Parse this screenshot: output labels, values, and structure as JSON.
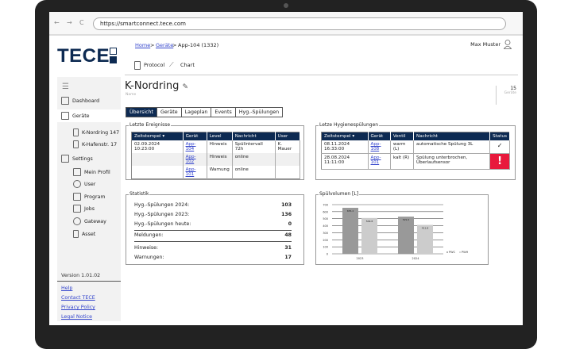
{
  "browser": {
    "back": "←",
    "forward": "→",
    "reload": "C",
    "url": "https://smartconnect.tece.com"
  },
  "logo": "TECE",
  "breadcrumb": {
    "home": "Home",
    "sep1": ">",
    "geraete": "Geräte",
    "sep2": ">",
    "current": "App-104 (1332)"
  },
  "user": {
    "name": "Max Muster"
  },
  "toolbar": {
    "protocol": "Protocol",
    "chart": "Chart"
  },
  "sidebar": {
    "items": [
      {
        "label": "Dashboard"
      },
      {
        "label": "Geräte"
      },
      {
        "label": "K-Nordring 147"
      },
      {
        "label": "K-Hafenstr. 17"
      },
      {
        "label": "Settings"
      },
      {
        "label": "Mein Profil"
      },
      {
        "label": "User"
      },
      {
        "label": "Program"
      },
      {
        "label": "Jobs"
      },
      {
        "label": "Gateway"
      },
      {
        "label": "Asset"
      }
    ],
    "version": "Version 1.01.02",
    "links": [
      "Help",
      "Contact TECE",
      "Privacy Policy",
      "Legal Notice"
    ]
  },
  "page": {
    "title": "K-Nordring",
    "name_label": "Name",
    "count": "15",
    "count_label": "Geräte"
  },
  "tabs": [
    "Übersicht",
    "Geräte",
    "Lageplan",
    "Events",
    "Hyg.-Spülungen"
  ],
  "events": {
    "legend": "Letzte Ereignisse",
    "headers": [
      "Zeitstempel ▾",
      "Gerät",
      "Level",
      "Nachricht",
      "User"
    ],
    "rows": [
      [
        "02.09.2024  10:23:00",
        "App-104",
        "Hinweis",
        "Spülintervall 72h",
        "K. Mauer"
      ],
      [
        "",
        "App-102",
        "Hinweis",
        "online",
        ""
      ],
      [
        "",
        "App-101",
        "Warnung",
        "online",
        ""
      ]
    ]
  },
  "flushes": {
    "legend": "Letze Hygienespülungen",
    "headers": [
      "Zeitstempel ▾",
      "Gerät",
      "Ventil",
      "Nachricht",
      "Status"
    ],
    "rows": [
      [
        "08.11.2024  16:33:00",
        "App-108",
        "warm (L)",
        "automatische Spülung 3L",
        "✓"
      ],
      [
        "28.08.2024  11:11:00",
        "App-101",
        "kalt (R)",
        "Spülung unterbrochen, Überlaufsensor",
        "!"
      ]
    ],
    "error_color": "#e8193c"
  },
  "stats": {
    "legend": "Statistik",
    "rows": [
      [
        "Hyg.-Spülungen 2024:",
        "103"
      ],
      [
        "Hyg.-Spülungen 2023:",
        "136"
      ],
      [
        "Hyg.-Spülungen heute:",
        "0"
      ],
      [
        "Meldungen:",
        "48"
      ],
      [
        "Hinweise:",
        "31"
      ],
      [
        "Warnungen:",
        "17"
      ]
    ]
  },
  "chart_data": {
    "type": "bar",
    "title": "Spülvolumen [L]",
    "categories": [
      "2023",
      "2024"
    ],
    "series": [
      {
        "name": "PWC",
        "values": [
          655.2,
          529.2
        ],
        "color": "#999999"
      },
      {
        "name": "PWH",
        "values": [
          509.8,
          411.8
        ],
        "color": "#cccccc"
      }
    ],
    "ylim": [
      0,
      700
    ],
    "yticks": [
      0,
      100,
      200,
      300,
      400,
      500,
      600,
      700
    ],
    "grid": true,
    "legend": "bottom-right"
  }
}
